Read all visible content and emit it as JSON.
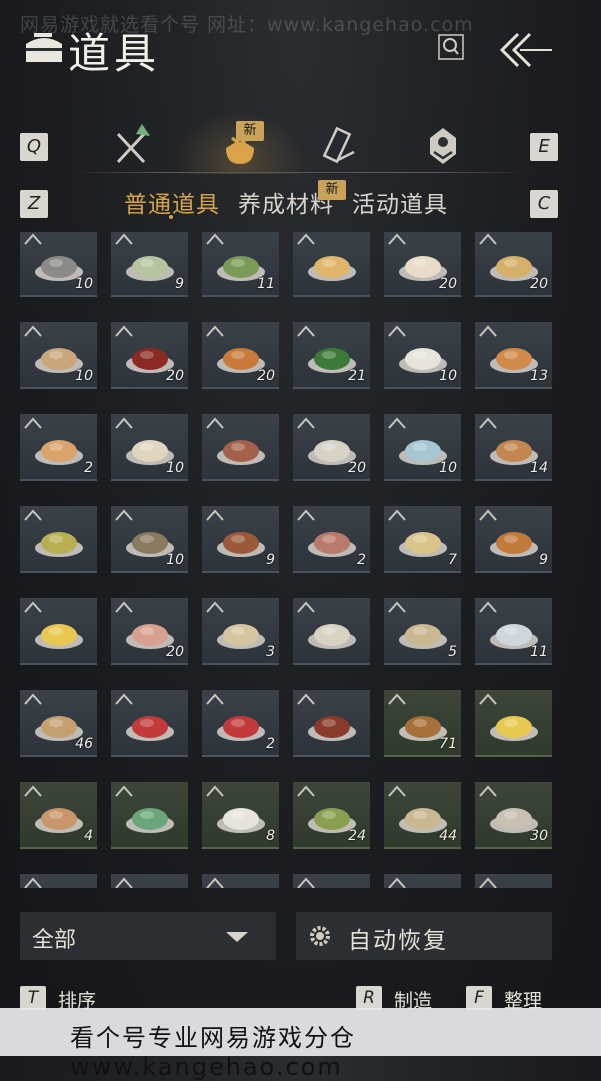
{
  "watermark_top": "网易游戏就选看个号  网址：www.kangehao.com",
  "header": {
    "title": "道具"
  },
  "keys": {
    "prev_tab": "Q",
    "next_tab": "E",
    "prev_sub": "Z",
    "next_sub": "C"
  },
  "category_tabs": [
    {
      "name": "weapon",
      "icon": "crossed-swords-icon",
      "badge": ""
    },
    {
      "name": "items",
      "icon": "money-bag-icon",
      "badge": "新",
      "active": true
    },
    {
      "name": "scroll",
      "icon": "scroll-icon",
      "badge": ""
    },
    {
      "name": "gem",
      "icon": "gem-icon",
      "badge": ""
    }
  ],
  "sub_tabs": [
    {
      "label": "普通道具",
      "active": true
    },
    {
      "label": "养成材料",
      "badge": "新"
    },
    {
      "label": "活动道具"
    }
  ],
  "items": [
    {
      "count": "10",
      "art": "fish"
    },
    {
      "count": "9",
      "art": "soup-green"
    },
    {
      "count": "11",
      "art": "greens"
    },
    {
      "count": "",
      "art": "egg-soup"
    },
    {
      "count": "20",
      "art": "bun"
    },
    {
      "count": "20",
      "art": "noodles"
    },
    {
      "count": "10",
      "art": "porridge"
    },
    {
      "count": "20",
      "art": "tea-red"
    },
    {
      "count": "20",
      "art": "stew-orange"
    },
    {
      "count": "21",
      "art": "spinach"
    },
    {
      "count": "10",
      "art": "dumplings"
    },
    {
      "count": "13",
      "art": "soup-red"
    },
    {
      "count": "2",
      "art": "bowl-orange"
    },
    {
      "count": "10",
      "art": "tofu"
    },
    {
      "count": "",
      "art": "meat-plate"
    },
    {
      "count": "20",
      "art": "rice-bowl"
    },
    {
      "count": "10",
      "art": "vase"
    },
    {
      "count": "14",
      "art": "stir-fry"
    },
    {
      "count": "",
      "art": "herb-plate"
    },
    {
      "count": "10",
      "art": "mushroom"
    },
    {
      "count": "9",
      "art": "pot-stew"
    },
    {
      "count": "2",
      "art": "pork-slices"
    },
    {
      "count": "7",
      "art": "tofu-soup"
    },
    {
      "count": "9",
      "art": "fried-bits"
    },
    {
      "count": "",
      "art": "cake-yellow"
    },
    {
      "count": "20",
      "art": "peach"
    },
    {
      "count": "3",
      "art": "scroll-art"
    },
    {
      "count": "",
      "art": "jar"
    },
    {
      "count": "5",
      "art": "paper"
    },
    {
      "count": "11",
      "art": "lantern"
    },
    {
      "count": "46",
      "art": "horn"
    },
    {
      "count": "",
      "art": "red-envelope"
    },
    {
      "count": "2",
      "art": "red-envelope"
    },
    {
      "count": "",
      "art": "hotpot"
    },
    {
      "count": "71",
      "art": "clay-pot",
      "green": true
    },
    {
      "count": "",
      "art": "cake-yellow",
      "green": true
    },
    {
      "count": "4",
      "art": "biscuit",
      "green": true
    },
    {
      "count": "",
      "art": "teapot",
      "green": true
    },
    {
      "count": "8",
      "art": "rice-cakes",
      "green": true
    },
    {
      "count": "24",
      "art": "herb-powder",
      "green": true
    },
    {
      "count": "44",
      "art": "worm-paper",
      "green": true
    },
    {
      "count": "30",
      "art": "sack",
      "green": true
    },
    {
      "count": "",
      "art": "feather"
    },
    {
      "count": "",
      "art": "brush"
    },
    {
      "count": "",
      "art": "misc"
    },
    {
      "count": "",
      "art": "misc"
    },
    {
      "count": "",
      "art": "misc"
    },
    {
      "count": "",
      "art": "misc"
    }
  ],
  "filter": {
    "label": "全部"
  },
  "auto_restore": {
    "label": "自动恢复"
  },
  "bottom": [
    {
      "key": "T",
      "label": "排序"
    },
    {
      "key": "R",
      "label": "制造"
    },
    {
      "key": "F",
      "label": "整理"
    }
  ],
  "watermark_bottom": "看个号专业网易游戏分仓 www.kangehao.com",
  "colors": {
    "accent": "#d9a449",
    "badge": "#c9a35a",
    "slot": "#333a42",
    "slot_green": "#36402f"
  }
}
